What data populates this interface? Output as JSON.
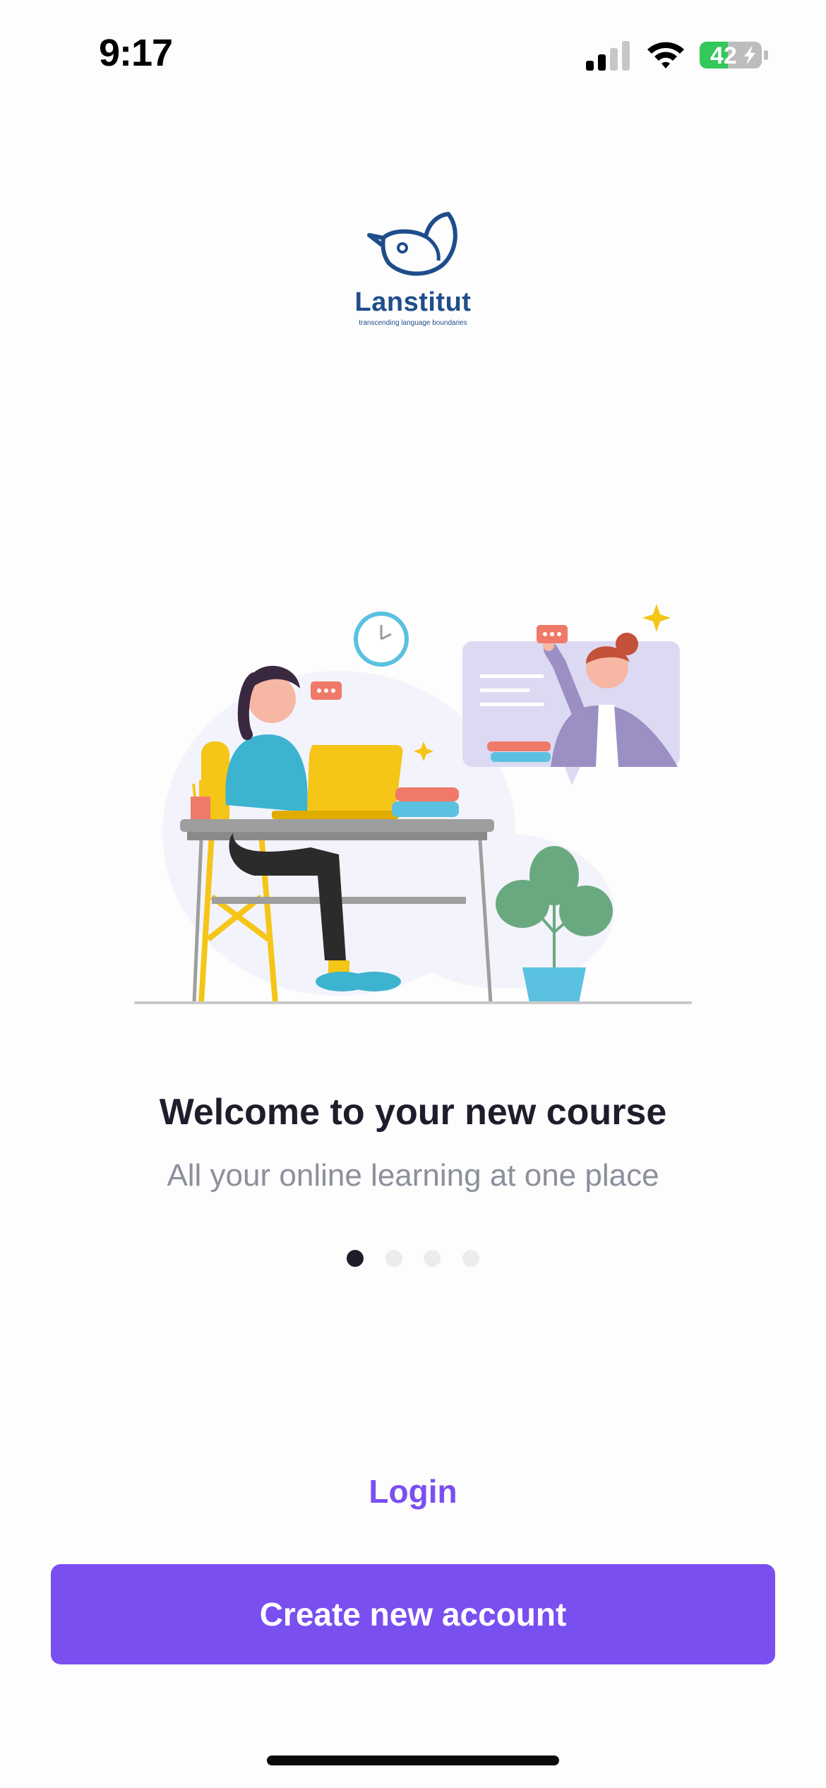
{
  "status_bar": {
    "time": "9:17",
    "battery_level": "42",
    "icons": [
      "signal-icon",
      "wifi-icon",
      "battery-charging-icon"
    ]
  },
  "logo": {
    "name": "Lanstitut",
    "tagline": "transcending language boundaries"
  },
  "onboarding": {
    "title": "Welcome to your new course",
    "subtitle": "All your online learning at one place",
    "page_count": 4,
    "active_page": 1
  },
  "actions": {
    "login_label": "Login",
    "create_account_label": "Create new account"
  },
  "colors": {
    "accent": "#7A4FF0",
    "title_text": "#1D1D2B",
    "subtitle_text": "#8C8F9C",
    "logo_blue": "#1F4D8C",
    "battery_green": "#34C759"
  }
}
